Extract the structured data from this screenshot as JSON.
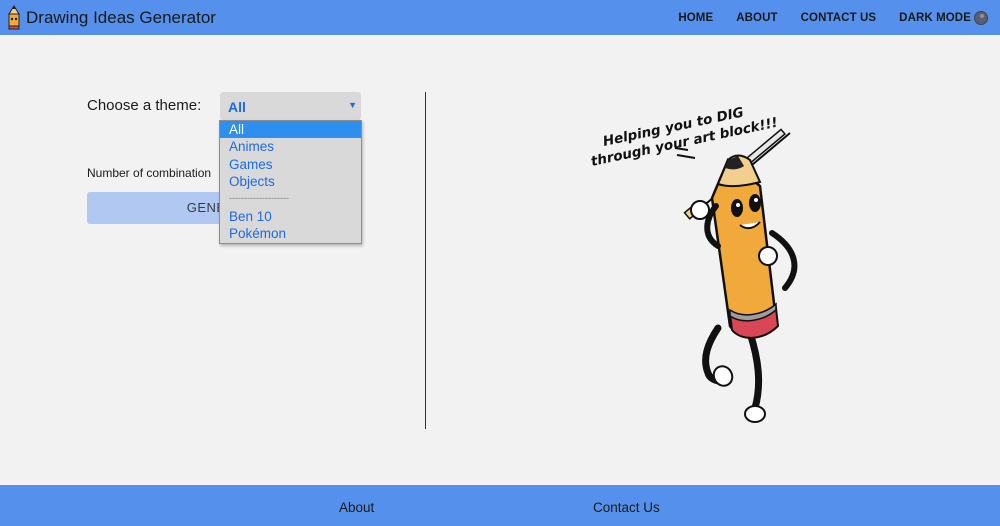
{
  "app": {
    "title": "Drawing Ideas Generator"
  },
  "nav": {
    "home": "HOME",
    "about": "ABOUT",
    "contact": "CONTACT US",
    "dark_mode": "DARK MODE",
    "dark_mode_icon": "moon-icon"
  },
  "form": {
    "theme_label": "Choose a theme:",
    "theme_selected": "All",
    "theme_options": [
      "All",
      "Animes",
      "Games",
      "Objects",
      "--------------------",
      "Ben 10",
      "Pokémon"
    ],
    "combination_label": "Number of combination",
    "generate_label": "GENERATE"
  },
  "illustration": {
    "caption_line1": "Helping you to DIG",
    "caption_line2": "through your art block!!!"
  },
  "footer": {
    "about": "About",
    "contact": "Contact Us"
  },
  "colors": {
    "accent": "#5591ec",
    "select_text": "#1d6ae6",
    "selected_option_bg": "#2e8ff0",
    "button_bg": "#b1c9f2",
    "page_bg": "#f2f2f2"
  }
}
